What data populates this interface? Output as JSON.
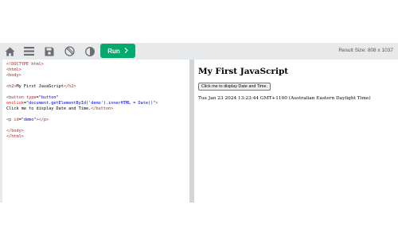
{
  "toolbar": {
    "icons": [
      "home-icon",
      "menu-icon",
      "save-icon",
      "orientation-icon",
      "theme-icon"
    ],
    "run_label": "Run",
    "result_size_label": "Result Size: 808 x 1037"
  },
  "code_editor": {
    "lines": [
      "<!DOCTYPE html>",
      "<html>",
      "<body>",
      "",
      "<h2>My First JavaScript</h2>",
      "",
      "<button type=\"button\"",
      "onclick=\"document.getElementById('demo').innerHTML = Date()\">",
      "Click me to display Date and Time.</button>",
      "",
      "<p id=\"demo\"></p>",
      "",
      "</body>",
      "</html>"
    ]
  },
  "result": {
    "heading": "My First JavaScript",
    "button_label": "Click me to display Date and Time.",
    "demo_text": "Tue Jan 23 2024 13:23:44 GMT+1100 (Australian Eastern Daylight Time)"
  },
  "colors": {
    "run_button": "#04aa6d",
    "toolbar_bg": "#e7e9eb",
    "divider": "#d3d6d9",
    "code_tag": "#a52a2a",
    "code_attr": "#ff0000",
    "code_string": "#0000cd"
  }
}
